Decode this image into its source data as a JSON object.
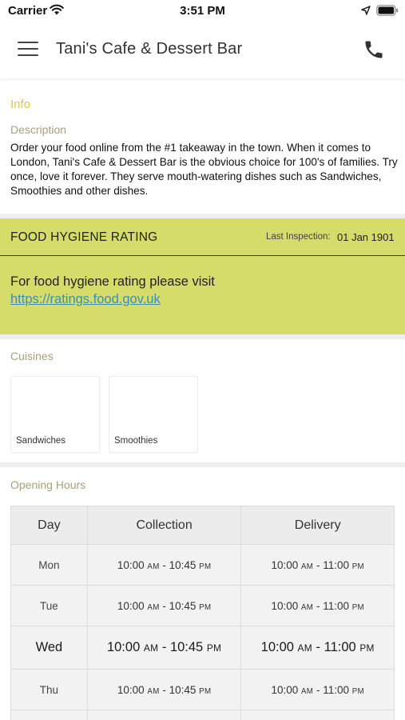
{
  "status_bar": {
    "carrier": "Carrier",
    "time": "3:51 PM"
  },
  "header": {
    "title": "Tani's Cafe & Dessert Bar"
  },
  "info": {
    "title": "Info",
    "description_label": "Description",
    "description": "Order your food online from the #1 takeaway in the town. When it comes to London, Tani's Cafe & Dessert Bar is the obvious choice for 100's of families. Try once, love it forever. They serve mouth-watering dishes such as Sandwiches, Smoothies  and other dishes."
  },
  "hygiene": {
    "title": "FOOD HYGIENE RATING",
    "last_inspection_label": "Last Inspection:",
    "last_inspection_date": "01 Jan 1901",
    "text": "For food hygiene rating please visit",
    "link": "https://ratings.food.gov.uk"
  },
  "cuisines": {
    "label": "Cuisines",
    "items": [
      {
        "name": "Sandwiches"
      },
      {
        "name": "Smoothies"
      }
    ]
  },
  "opening_hours": {
    "label": "Opening Hours",
    "columns": [
      "Day",
      "Collection",
      "Delivery"
    ],
    "rows": [
      {
        "day": "Mon",
        "c_open": "10:00",
        "c_open_ap": "AM",
        "c_close": "10:45",
        "c_close_ap": "PM",
        "d_open": "10:00",
        "d_open_ap": "AM",
        "d_close": "11:00",
        "d_close_ap": "PM"
      },
      {
        "day": "Tue",
        "c_open": "10:00",
        "c_open_ap": "AM",
        "c_close": "10:45",
        "c_close_ap": "PM",
        "d_open": "10:00",
        "d_open_ap": "AM",
        "d_close": "11:00",
        "d_close_ap": "PM"
      },
      {
        "day": "Wed",
        "c_open": "10:00",
        "c_open_ap": "AM",
        "c_close": "10:45",
        "c_close_ap": "PM",
        "d_open": "10:00",
        "d_open_ap": "AM",
        "d_close": "11:00",
        "d_close_ap": "PM"
      },
      {
        "day": "Thu",
        "c_open": "10:00",
        "c_open_ap": "AM",
        "c_close": "10:45",
        "c_close_ap": "PM",
        "d_open": "10:00",
        "d_open_ap": "AM",
        "d_close": "11:00",
        "d_close_ap": "PM"
      }
    ]
  },
  "colors": {
    "accent": "#e8c33a",
    "hygiene_bg": "#d6dc6a",
    "link": "#3a8fb0"
  },
  "icons": [
    "wifi-icon",
    "location-arrow-icon",
    "battery-icon",
    "hamburger-menu-icon",
    "phone-icon"
  ]
}
